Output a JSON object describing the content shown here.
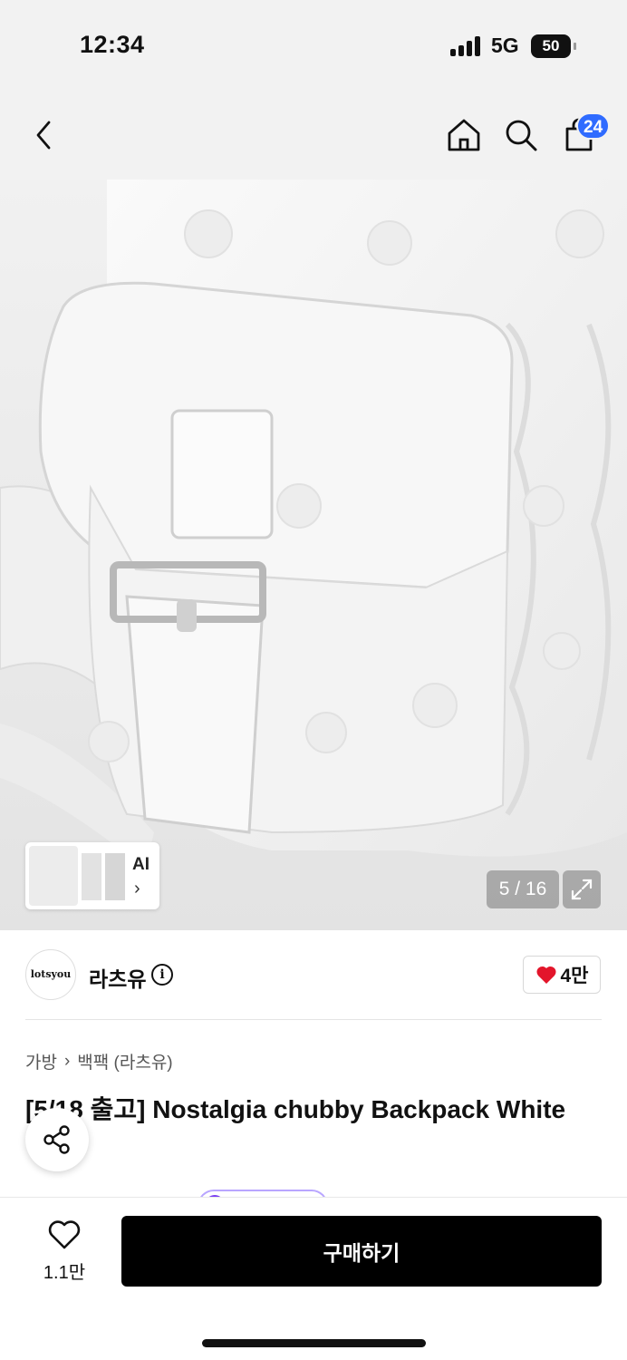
{
  "status_bar": {
    "time": "12:34",
    "network": "5G",
    "battery": "50"
  },
  "header": {
    "back_icon": "chevron-left-icon",
    "home_icon": "home-icon",
    "search_icon": "search-icon",
    "cart_icon": "shopping-bag-icon",
    "cart_count": "24",
    "badge_color": "#2f6bff"
  },
  "gallery": {
    "ai_label": "AI",
    "ai_chevron": "›",
    "counter": "5 / 16",
    "current_index": 5,
    "total": 16,
    "expand_icon": "expand-icon"
  },
  "brand": {
    "logo_text": "lotsyou",
    "name": "라츠유",
    "info_icon": "info-icon",
    "likes": "4만",
    "heart_color": "#e3152b"
  },
  "breadcrumb": {
    "category": "가방",
    "separator": "›",
    "subcategory": "백팩 (라츠유)"
  },
  "product": {
    "title": "[5/18 출고] Nostalgia chubby Backpack White"
  },
  "bottom_bar": {
    "wishlist_count": "1.1만",
    "buy_label": "구매하기"
  }
}
